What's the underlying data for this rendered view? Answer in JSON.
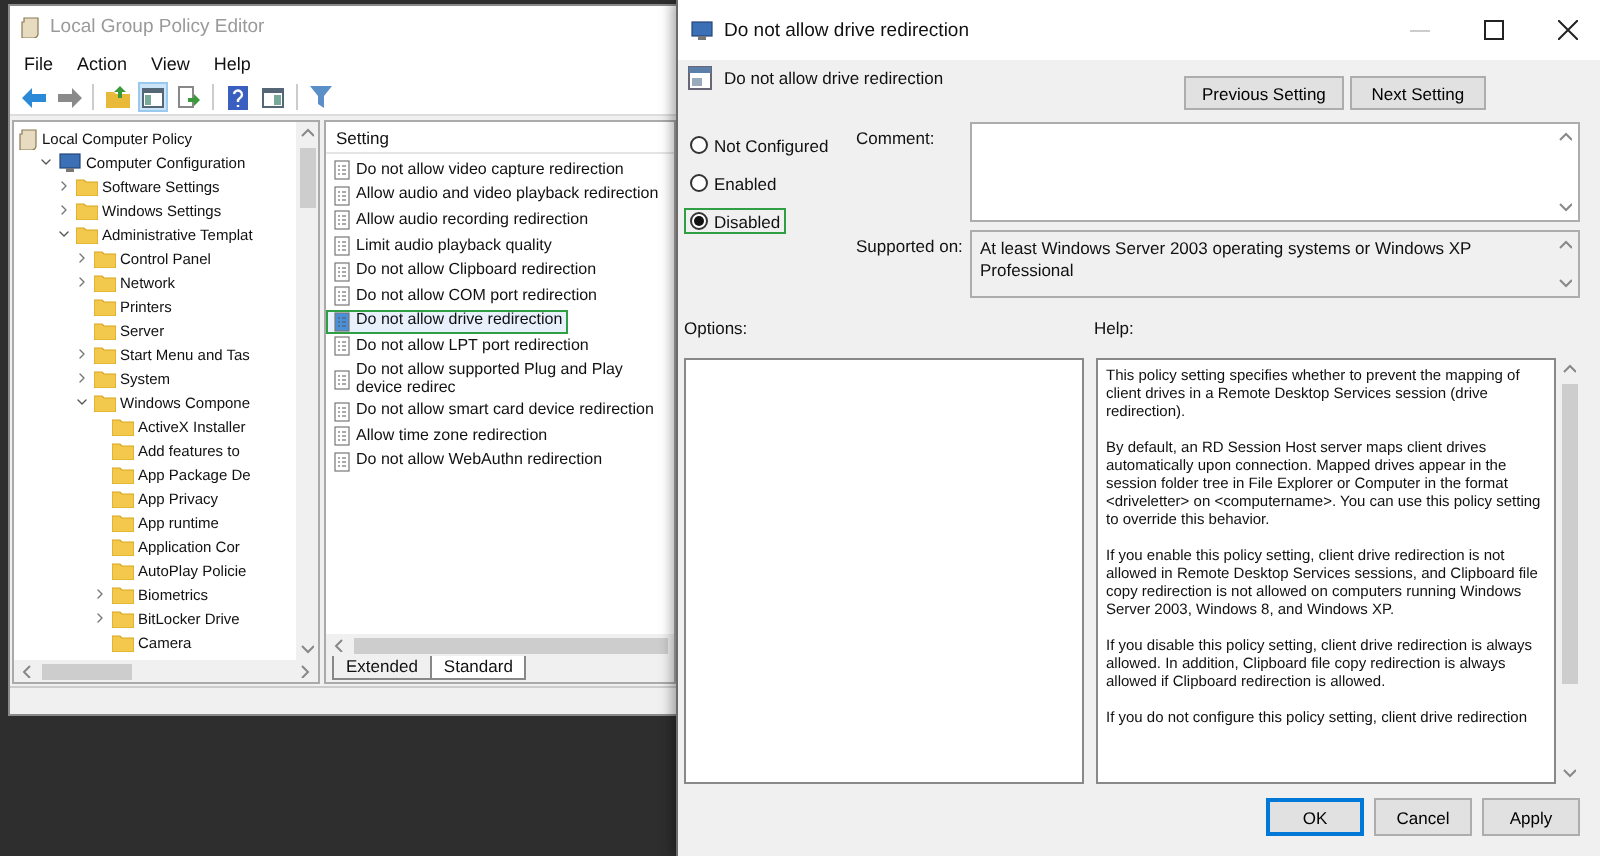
{
  "main_window": {
    "title": "Local Group Policy Editor",
    "menu": [
      "File",
      "Action",
      "View",
      "Help"
    ],
    "tree": [
      {
        "label": "Local Computer Policy",
        "kind": "policy",
        "expandable": false,
        "children": [
          {
            "label": "Computer Configuration",
            "kind": "computer",
            "expandable": true,
            "expanded": true,
            "children": [
              {
                "label": "Software Settings",
                "kind": "folder",
                "expandable": true,
                "expanded": false
              },
              {
                "label": "Windows Settings",
                "kind": "folder",
                "expandable": true,
                "expanded": false
              },
              {
                "label": "Administrative Templat",
                "kind": "folder",
                "expandable": true,
                "expanded": true,
                "children": [
                  {
                    "label": "Control Panel",
                    "kind": "folder",
                    "expandable": true,
                    "expanded": false
                  },
                  {
                    "label": "Network",
                    "kind": "folder",
                    "expandable": true,
                    "expanded": false
                  },
                  {
                    "label": "Printers",
                    "kind": "folder",
                    "expandable": false
                  },
                  {
                    "label": "Server",
                    "kind": "folder",
                    "expandable": false
                  },
                  {
                    "label": "Start Menu and Tas",
                    "kind": "folder",
                    "expandable": true,
                    "expanded": false
                  },
                  {
                    "label": "System",
                    "kind": "folder",
                    "expandable": true,
                    "expanded": false
                  },
                  {
                    "label": "Windows Compone",
                    "kind": "folder",
                    "expandable": true,
                    "expanded": true,
                    "children": [
                      {
                        "label": "ActiveX Installer",
                        "kind": "folder",
                        "expandable": false
                      },
                      {
                        "label": "Add features to",
                        "kind": "folder",
                        "expandable": false
                      },
                      {
                        "label": "App Package De",
                        "kind": "folder",
                        "expandable": false
                      },
                      {
                        "label": "App Privacy",
                        "kind": "folder",
                        "expandable": false
                      },
                      {
                        "label": "App runtime",
                        "kind": "folder",
                        "expandable": false
                      },
                      {
                        "label": "Application Cor",
                        "kind": "folder",
                        "expandable": false
                      },
                      {
                        "label": "AutoPlay Policie",
                        "kind": "folder",
                        "expandable": false
                      },
                      {
                        "label": "Biometrics",
                        "kind": "folder",
                        "expandable": true,
                        "expanded": false
                      },
                      {
                        "label": "BitLocker Drive",
                        "kind": "folder",
                        "expandable": true,
                        "expanded": false
                      },
                      {
                        "label": "Camera",
                        "kind": "folder",
                        "expandable": false
                      }
                    ]
                  }
                ]
              }
            ]
          }
        ]
      }
    ],
    "list": {
      "column": "Setting",
      "rows": [
        {
          "label": "Do not allow video capture redirection",
          "selected": false
        },
        {
          "label": "Allow audio and video playback redirection",
          "selected": false
        },
        {
          "label": "Allow audio recording redirection",
          "selected": false
        },
        {
          "label": "Limit audio playback quality",
          "selected": false
        },
        {
          "label": "Do not allow Clipboard redirection",
          "selected": false
        },
        {
          "label": "Do not allow COM port redirection",
          "selected": false
        },
        {
          "label": "Do not allow drive redirection",
          "selected": true
        },
        {
          "label": "Do not allow LPT port redirection",
          "selected": false
        },
        {
          "label": "Do not allow supported Plug and Play device redirec",
          "selected": false
        },
        {
          "label": "Do not allow smart card device redirection",
          "selected": false
        },
        {
          "label": "Allow time zone redirection",
          "selected": false
        },
        {
          "label": "Do not allow WebAuthn redirection",
          "selected": false
        }
      ]
    },
    "tabs": [
      {
        "label": "Extended",
        "selected": false
      },
      {
        "label": "Standard",
        "selected": true
      }
    ]
  },
  "dialog": {
    "title": "Do not allow drive redirection",
    "heading": "Do not allow drive redirection",
    "nav_buttons": [
      "Previous Setting",
      "Next Setting"
    ],
    "states": [
      {
        "label": "Not Configured",
        "selected": false
      },
      {
        "label": "Enabled",
        "selected": false
      },
      {
        "label": "Disabled",
        "selected": true
      }
    ],
    "comment_label": "Comment:",
    "supported_label": "Supported on:",
    "supported_value": "At least Windows Server 2003 operating systems or Windows XP Professional",
    "options_label": "Options:",
    "help_label": "Help:",
    "help": [
      "This policy setting specifies whether to prevent the mapping of client drives in a Remote Desktop Services session (drive redirection).",
      "By default, an RD Session Host server maps client drives automatically upon connection. Mapped drives appear in the session folder tree in File Explorer or Computer in the format <driveletter> on <computername>. You can use this policy setting to override this behavior.",
      "If you enable this policy setting, client drive redirection is not allowed in Remote Desktop Services sessions, and Clipboard file copy redirection is not allowed on computers running Windows Server 2003, Windows 8, and Windows XP.",
      "If you disable this policy setting, client drive redirection is always allowed. In addition, Clipboard file copy redirection is always allowed if Clipboard redirection is allowed.",
      "If you do not configure this policy setting, client drive redirection"
    ],
    "buttons": [
      {
        "label": "OK",
        "default": true
      },
      {
        "label": "Cancel",
        "default": false
      },
      {
        "label": "Apply",
        "default": false
      }
    ]
  }
}
